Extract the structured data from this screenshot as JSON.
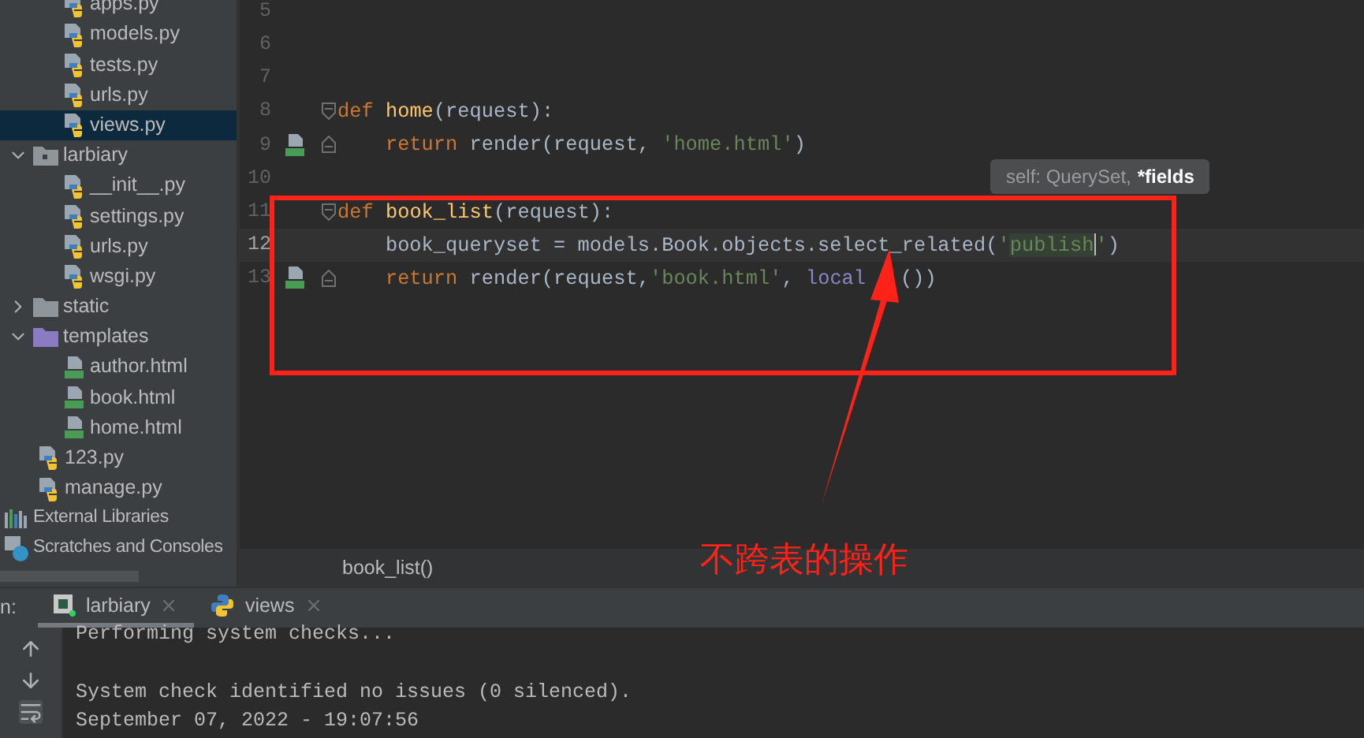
{
  "project_tree": {
    "orphan_children": [
      {
        "label": "apps.py",
        "kind": "python",
        "selected": false
      },
      {
        "label": "models.py",
        "kind": "python",
        "selected": false
      },
      {
        "label": "tests.py",
        "kind": "python",
        "selected": false
      },
      {
        "label": "urls.py",
        "kind": "python",
        "selected": false
      },
      {
        "label": "views.py",
        "kind": "python",
        "selected": true
      }
    ],
    "items": [
      {
        "label": "larbiary",
        "kind": "package",
        "expanded": true,
        "selected": false,
        "children": [
          {
            "label": "__init__.py",
            "kind": "python",
            "selected": false
          },
          {
            "label": "settings.py",
            "kind": "python",
            "selected": false
          },
          {
            "label": "urls.py",
            "kind": "python",
            "selected": false
          },
          {
            "label": "wsgi.py",
            "kind": "python",
            "selected": false
          }
        ]
      },
      {
        "label": "static",
        "kind": "folder",
        "expanded": false,
        "selected": false
      },
      {
        "label": "templates",
        "kind": "templates",
        "expanded": true,
        "selected": false,
        "children": [
          {
            "label": "author.html",
            "kind": "html",
            "selected": false
          },
          {
            "label": "book.html",
            "kind": "html",
            "selected": false
          },
          {
            "label": "home.html",
            "kind": "html",
            "selected": false
          }
        ]
      },
      {
        "label": "123.py",
        "kind": "python",
        "selected": false
      },
      {
        "label": "manage.py",
        "kind": "python",
        "selected": false
      }
    ],
    "roots": [
      {
        "label": "External Libraries",
        "kind": "libraries"
      },
      {
        "label": "Scratches and Consoles",
        "kind": "scratches"
      }
    ]
  },
  "editor": {
    "lines": [
      {
        "number": "5",
        "current": false,
        "gutter_icon": false,
        "fold_start": false,
        "fold_end": false
      },
      {
        "number": "6",
        "current": false,
        "gutter_icon": false,
        "fold_start": false,
        "fold_end": false
      },
      {
        "number": "7",
        "current": false,
        "gutter_icon": false,
        "fold_start": false,
        "fold_end": false
      },
      {
        "number": "8",
        "current": false,
        "gutter_icon": false,
        "fold_start": true,
        "fold_end": false,
        "tokens": [
          {
            "text": "def ",
            "kind": "keyword"
          },
          {
            "text": "home",
            "kind": "function"
          },
          {
            "text": "(request):",
            "kind": "plain"
          }
        ]
      },
      {
        "number": "9",
        "current": false,
        "gutter_icon": true,
        "fold_start": false,
        "fold_end": true,
        "tokens": [
          {
            "text": "    return",
            "kind": "keyword"
          },
          {
            "text": " render(request, ",
            "kind": "plain"
          },
          {
            "text": "'home.html'",
            "kind": "string"
          },
          {
            "text": ")",
            "kind": "plain"
          }
        ]
      },
      {
        "number": "10",
        "current": false,
        "gutter_icon": false,
        "fold_start": false,
        "fold_end": false
      },
      {
        "number": "11",
        "current": false,
        "gutter_icon": false,
        "fold_start": true,
        "fold_end": false,
        "tokens": [
          {
            "text": "def ",
            "kind": "keyword"
          },
          {
            "text": "book_list",
            "kind": "function"
          },
          {
            "text": "(request):",
            "kind": "plain"
          }
        ]
      },
      {
        "number": "12",
        "current": true,
        "gutter_icon": false,
        "fold_start": false,
        "fold_end": false,
        "tokens": [
          {
            "text": "    book_queryset = models.Book.objects.select_related(",
            "kind": "plain"
          },
          {
            "text": "'",
            "kind": "string"
          },
          {
            "text": "publish",
            "kind": "string_match"
          },
          {
            "text": "'",
            "kind": "string"
          },
          {
            "text": ")",
            "kind": "plain"
          }
        ]
      },
      {
        "number": "13",
        "current": false,
        "gutter_icon": true,
        "fold_start": false,
        "fold_end": true,
        "tokens": [
          {
            "text": "    return",
            "kind": "keyword"
          },
          {
            "text": " render(request,",
            "kind": "plain"
          },
          {
            "text": "'book.html'",
            "kind": "string"
          },
          {
            "text": ", ",
            "kind": "plain"
          },
          {
            "text": "local",
            "kind": "builtin"
          },
          {
            "text": "())",
            "kind": "plain_after_arrow"
          }
        ]
      }
    ],
    "tooltip": {
      "dim_text": "self: QuerySet, ",
      "bold_text": "*fields"
    },
    "breadcrumb": "book_list()"
  },
  "annotation": {
    "text": "不跨表的操作",
    "color": "#ff2218"
  },
  "run_panel": {
    "label": "n:",
    "tabs": [
      {
        "label": "larbiary",
        "kind": "django",
        "selected": true
      },
      {
        "label": "views",
        "kind": "python",
        "selected": false
      }
    ],
    "output": [
      {
        "kind": "text",
        "text": "Performing system checks..."
      },
      {
        "kind": "blank"
      },
      {
        "kind": "text",
        "text": "System check identified no issues (0 silenced)."
      },
      {
        "kind": "text",
        "text": "September 07, 2022 - 19:07:56"
      }
    ]
  }
}
